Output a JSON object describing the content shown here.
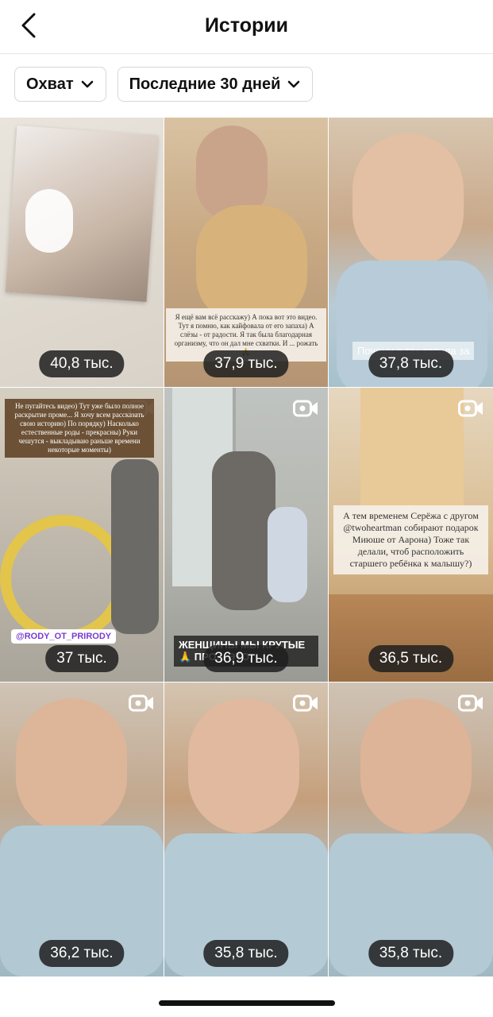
{
  "header": {
    "title": "Истории",
    "back_icon": "chevron-left-icon"
  },
  "filters": [
    {
      "label": "Охват"
    },
    {
      "label": "Последние 30 дней"
    }
  ],
  "stories": [
    {
      "count": "40,8 тыс.",
      "video": false
    },
    {
      "count": "37,9 тыс.",
      "video": false,
      "caption": "Я ещё вам всё расскажу) А пока вот это видео. Тут я помню, как кайфовала от его запаха) А слёзы - от радости. Я так была благодарная организму, что он дал мне схватки. И ... рожать🙏"
    },
    {
      "count": "37,8 тыс.",
      "video": false,
      "caption": "Почему я так топила за"
    },
    {
      "count": "37 тыс.",
      "video": true,
      "caption": "Не пугайтесь видео) Тут уже было полное раскрытие проме... Я хочу всем рассказать свою историю) По порядку) Насколько естественные роды - прекрасны) Руки чешутся - выкладываю раньше времени некоторые моменты)",
      "tag": "@RODY_OT_PRIRODY"
    },
    {
      "count": "36,9 тыс.",
      "video": true,
      "caption": "ЖЕНЩИНЫ МЫ КРУТЫЕ🙏 ПРО... ЭТО,"
    },
    {
      "count": "36,5 тыс.",
      "video": true,
      "caption": "А тем временем Серёжа с другом @twoheartman собирают подарок Миюше от Аарона) Тоже так делали, чтоб расположить старшего ребёнка к малышу?)"
    },
    {
      "count": "36,2 тыс.",
      "video": true
    },
    {
      "count": "35,8 тыс.",
      "video": true
    },
    {
      "count": "35,8 тыс.",
      "video": true
    }
  ],
  "colors": {
    "badge_bg": "#1e1e1e",
    "border": "#d7d7d7"
  }
}
